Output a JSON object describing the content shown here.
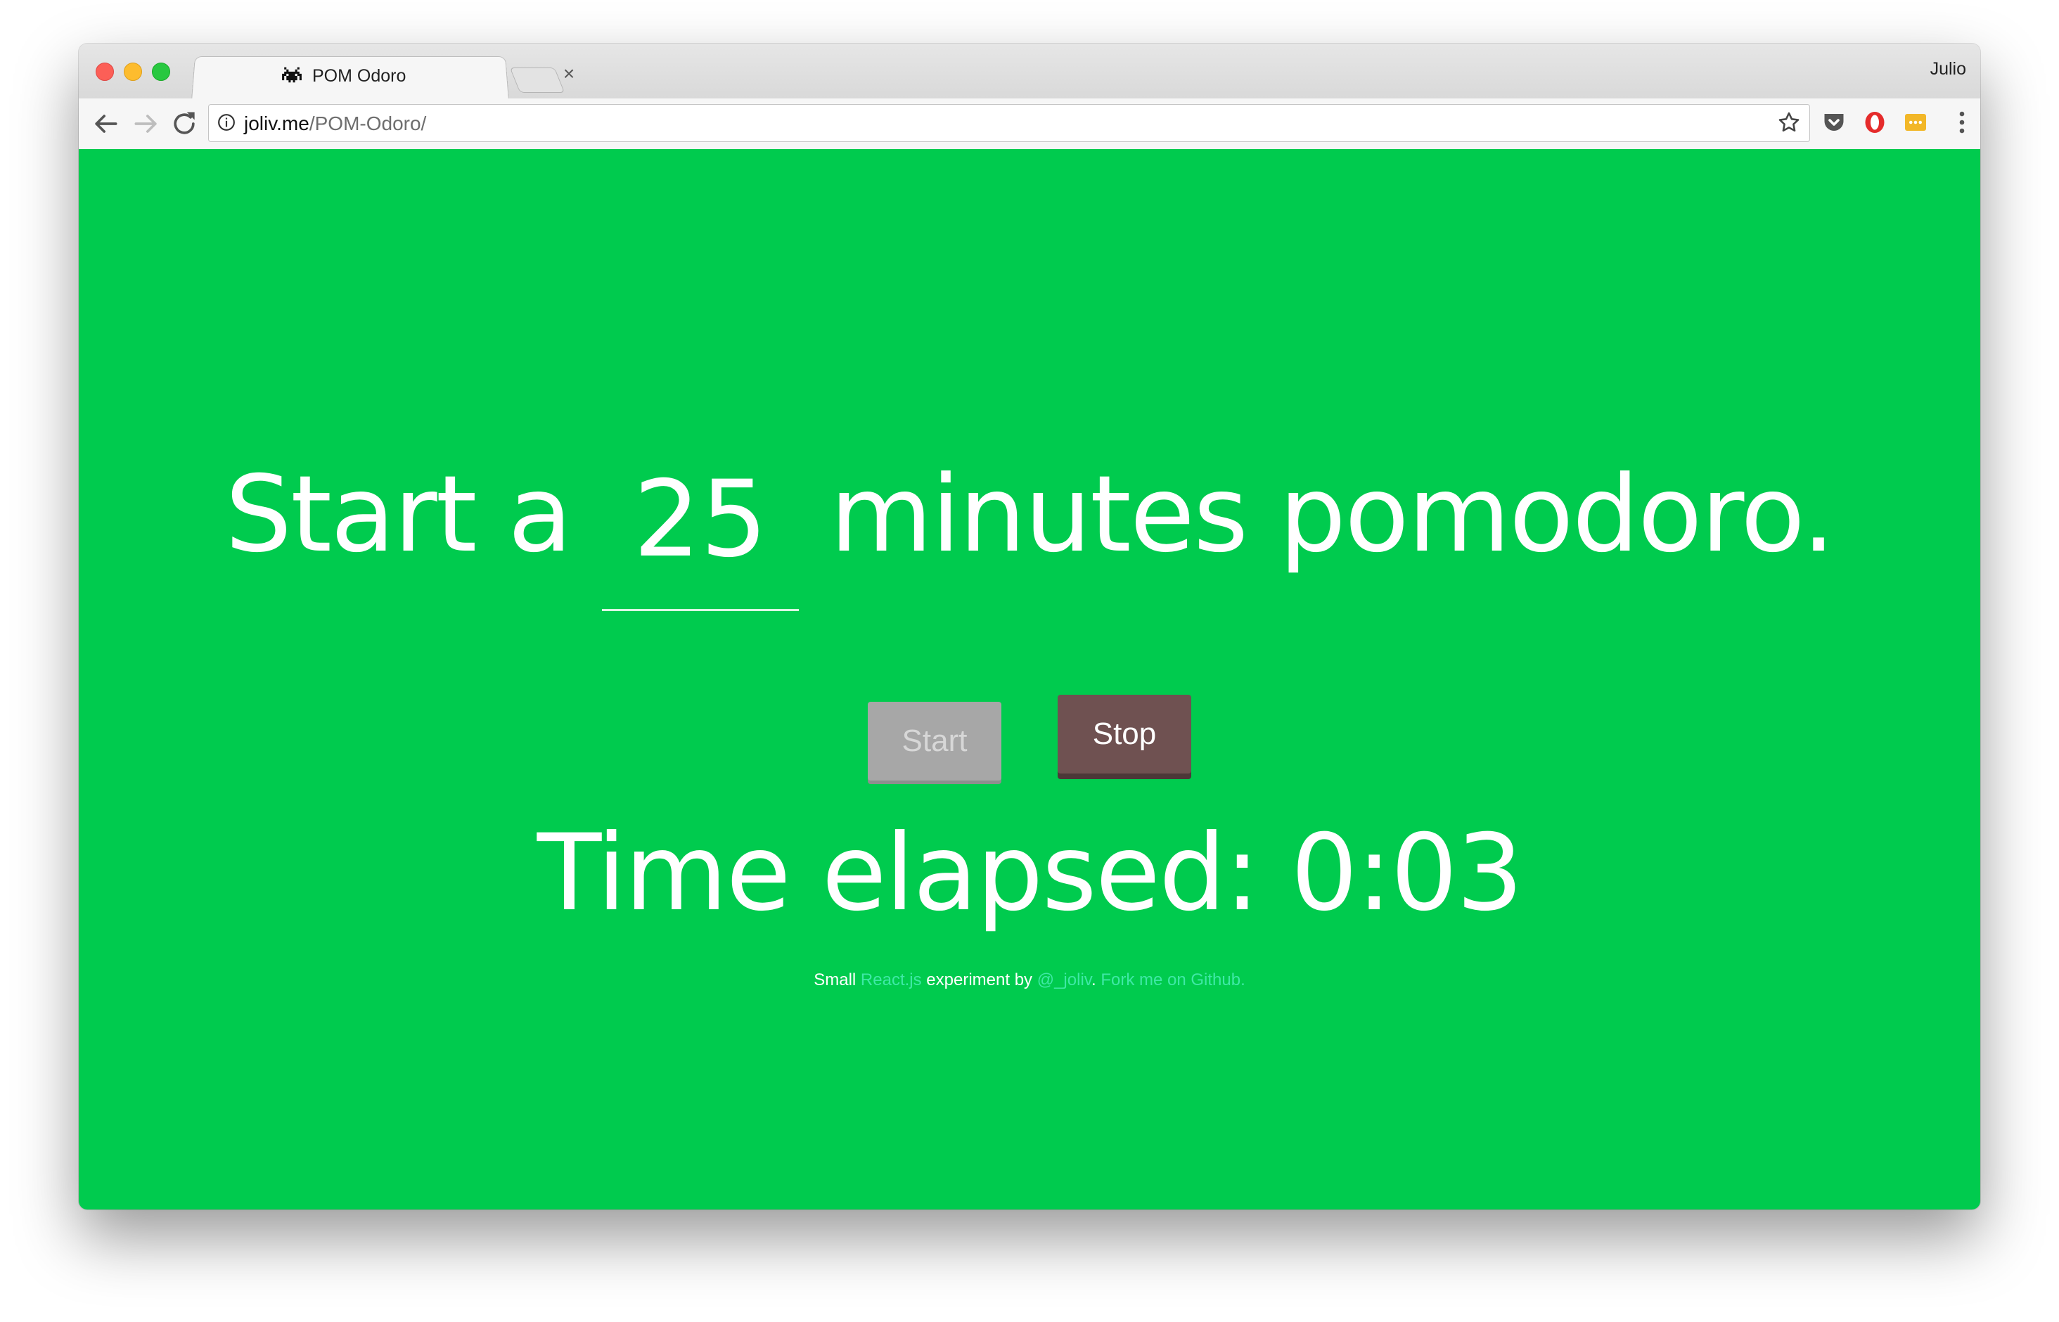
{
  "browser": {
    "tab": {
      "title": "POM Odoro",
      "audio_icon": "speaker-icon",
      "close_glyph": "×"
    },
    "profile_name": "Julio",
    "url": {
      "host": "joliv.me",
      "path": "/POM-Odoro/"
    }
  },
  "page": {
    "background_color": "#00cb4e",
    "headline": {
      "prefix": "Start a",
      "minutes_value": "25",
      "suffix": "minutes pomodoro."
    },
    "buttons": {
      "start_label": "Start",
      "stop_label": "Stop"
    },
    "elapsed": {
      "label": "Time elapsed:",
      "value": "0:03"
    },
    "credits": {
      "small": "Small",
      "react_link": "React.js",
      "experiment_by": "experiment by",
      "author_link": "@_joliv",
      "separator": ".",
      "fork_link": "Fork me on Github."
    }
  }
}
